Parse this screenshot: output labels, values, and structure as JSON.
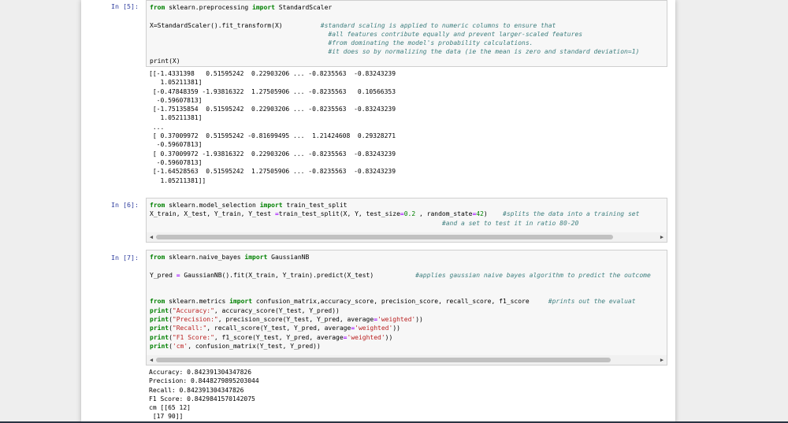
{
  "cells": [
    {
      "prompt": "In [5]:",
      "code": {
        "l1_from": "from",
        "l1_mod": " sklearn.preprocessing ",
        "l1_import": "import",
        "l1_name": " StandardScaler",
        "l3_code": "X=StandardScaler().fit_transform(X)",
        "c1": "#standard scaling is applied to numeric columns to ensure that",
        "c2": "#all features contribute equally and prevent larger-scaled features",
        "c3": "#from dominating the model's probability calculations.",
        "c4": "#it does so by normalizing the data (ie the mean is zero and standard deviation=1)",
        "l8": "print(X)"
      },
      "output": "[[-1.4331398   0.51595242  0.22903206 ... -0.8235563  -0.83243239\n   1.05211381]\n [-0.47848359 -1.93816322  1.27505906 ... -0.8235563   0.10566353\n  -0.59607813]\n [-1.75135854  0.51595242  0.22903206 ... -0.8235563  -0.83243239\n   1.05211381]\n ...\n [ 0.37009972  0.51595242 -0.81699495 ...  1.21424608  0.29328271\n  -0.59607813]\n [ 0.37009972 -1.93816322  0.22903206 ... -0.8235563  -0.83243239\n  -0.59607813]\n [-1.64528563  0.51595242  1.27505906 ... -0.8235563  -0.83243239\n   1.05211381]]"
    },
    {
      "prompt": "In [6]:",
      "code": {
        "l1_from": "from",
        "l1_mod": " sklearn.model_selection ",
        "l1_import": "import",
        "l1_name": " train_test_split",
        "l2_a": "X_train, X_test, Y_train, Y_test ",
        "l2_eq": "=",
        "l2_b": "train_test_split(X, Y, test_size",
        "l2_eq2": "=",
        "l2_n1": "0.2",
        "l2_c": " , random_state",
        "l2_eq3": "=",
        "l2_n2": "42",
        "l2_d": ")",
        "c1": "#splits the data into a training set",
        "c2": "#and a set to test it in ratio 80-20"
      }
    },
    {
      "prompt": "In [7]:",
      "code": {
        "l1_from": "from",
        "l1_mod": " sklearn.naive_bayes ",
        "l1_import": "import",
        "l1_name": " GaussianNB",
        "l3_a": "Y_pred ",
        "l3_eq": "=",
        "l3_b": " GaussianNB().fit(X_train, Y_train).predict(X_test)",
        "l3_c": "#applies gaussian naive bayes algorithm to predict the outcome",
        "l6_from": "from",
        "l6_mod": " sklearn.metrics ",
        "l6_import": "import",
        "l6_names": " confusion_matrix,accuracy_score, precision_score, recall_score, f1_score",
        "l6_c": "#prints out the evaluat",
        "p1_fn": "print",
        "p1_s": "\"Accuracy:\"",
        "p1_r": ", accuracy_score(Y_test, Y_pred))",
        "p2_fn": "print",
        "p2_s": "\"Precision:\"",
        "p2_r": ", precision_score(Y_test, Y_pred, average",
        "p2_eq": "=",
        "p2_s2": "'weighted'",
        "p2_end": "))",
        "p3_fn": "print",
        "p3_s": "\"Recall:\"",
        "p3_r": ", recall_score(Y_test, Y_pred, average",
        "p3_eq": "=",
        "p3_s2": "'weighted'",
        "p3_end": "))",
        "p4_fn": "print",
        "p4_s": "\"F1 Score:\"",
        "p4_r": ", f1_score(Y_test, Y_pred, average",
        "p4_eq": "=",
        "p4_s2": "'weighted'",
        "p4_end": "))",
        "p5_fn": "print",
        "p5_s": "'cm'",
        "p5_r": ", confusion_matrix(Y_test, Y_pred))"
      },
      "output": "Accuracy: 0.842391304347826\nPrecision: 0.8448279895203044\nRecall: 0.842391304347826\nF1 Score: 0.8429841570142075\ncm [[65 12]\n [17 90]]"
    }
  ]
}
